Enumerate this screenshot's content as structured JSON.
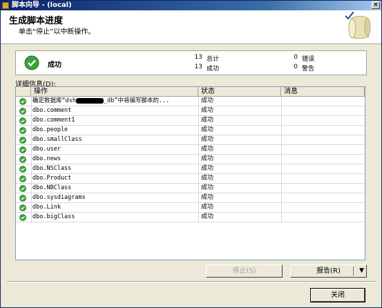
{
  "window": {
    "title": "脚本向导 - (local)",
    "close_glyph": "×"
  },
  "header": {
    "title": "生成脚本进度",
    "subtitle": "单击“停止”以中断操作。"
  },
  "summary": {
    "status": "成功",
    "total_count": "13",
    "total_label": "总计",
    "success_count": "13",
    "success_label": "成功",
    "error_count": "0",
    "error_label": "错误",
    "warning_count": "0",
    "warning_label": "警告"
  },
  "details_label": "详细信息(D):",
  "columns": {
    "operation": "操作",
    "status": "状态",
    "message": "消息"
  },
  "rows": [
    {
      "op_prefix": "确定数据库“dsh",
      "op_suffix": "_db”中将编写脚本的...",
      "status": "成功"
    },
    {
      "op": "dbo.comment",
      "status": "成功"
    },
    {
      "op": "dbo.comment1",
      "status": "成功"
    },
    {
      "op": "dbo.people",
      "status": "成功"
    },
    {
      "op": "dbo.smallClass",
      "status": "成功"
    },
    {
      "op": "dbo.user",
      "status": "成功"
    },
    {
      "op": "dbo.news",
      "status": "成功"
    },
    {
      "op": "dbo.NSClass",
      "status": "成功"
    },
    {
      "op": "dbo.Product",
      "status": "成功"
    },
    {
      "op": "dbo.NBClass",
      "status": "成功"
    },
    {
      "op": "dbo.sysdiagrams",
      "status": "成功"
    },
    {
      "op": "dbo.Link",
      "status": "成功"
    },
    {
      "op": "dbo.bigClass",
      "status": "成功"
    }
  ],
  "buttons": {
    "stop": "停止(S)",
    "report": "报告(R)",
    "report_arrow": "▼",
    "close": "关闭"
  },
  "colors": {
    "success_green": "#3CA33C",
    "title_bar": "#0A246A"
  },
  "icons": {
    "status": "check-circle-icon"
  }
}
